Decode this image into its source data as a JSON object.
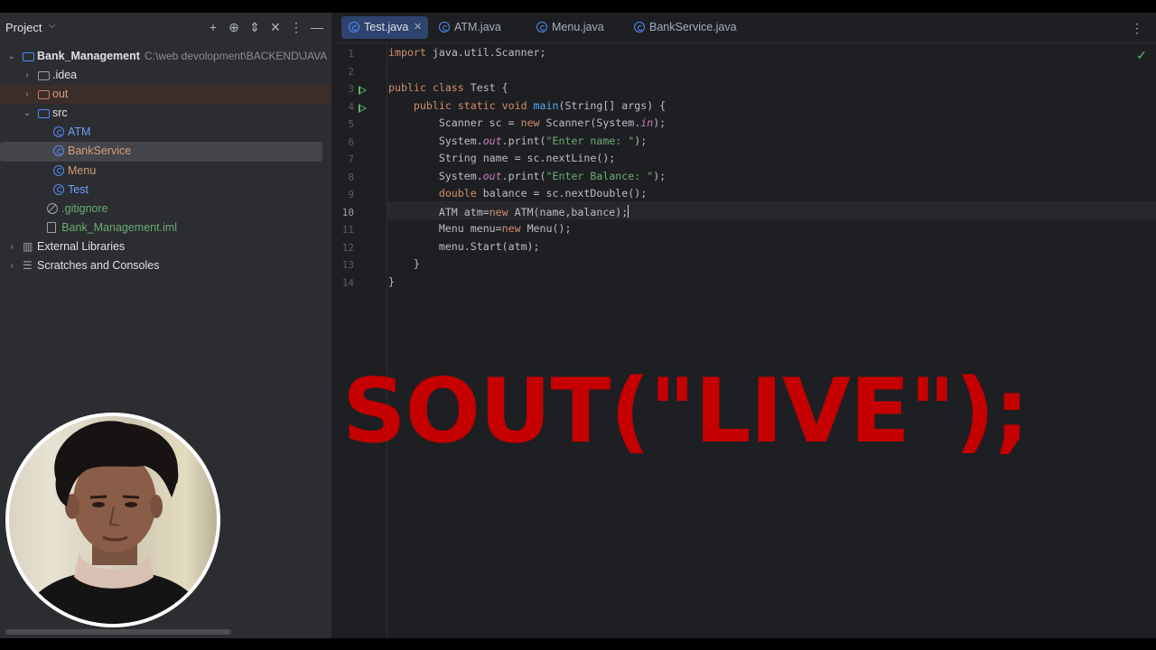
{
  "project": {
    "title": "Project",
    "tree": [
      {
        "label": "Bank_Management",
        "path": "C:\\web devolopment\\BACKEND\\JAVA",
        "icon": "module-folder-icon",
        "color": "white",
        "bold": true
      },
      {
        "label": ".idea",
        "icon": "folder-icon",
        "color": "white"
      },
      {
        "label": "out",
        "icon": "folder-icon",
        "color": "orange"
      },
      {
        "label": "src",
        "icon": "source-folder-icon",
        "color": "white"
      },
      {
        "label": "ATM",
        "icon": "java-class-icon",
        "color": "blue"
      },
      {
        "label": "BankService",
        "icon": "java-class-icon",
        "color": "orange"
      },
      {
        "label": "Menu",
        "icon": "java-class-icon",
        "color": "orange"
      },
      {
        "label": "Test",
        "icon": "java-class-icon",
        "color": "blue"
      },
      {
        "label": ".gitignore",
        "icon": "ignore-file-icon",
        "color": "green"
      },
      {
        "label": "Bank_Management.iml",
        "icon": "iml-file-icon",
        "color": "green"
      },
      {
        "label": "External Libraries",
        "icon": "library-icon",
        "color": "white"
      },
      {
        "label": "Scratches and Consoles",
        "icon": "scratches-icon",
        "color": "white"
      }
    ]
  },
  "tabs": [
    {
      "label": "Test.java",
      "active": true
    },
    {
      "label": "ATM.java",
      "active": false
    },
    {
      "label": "Menu.java",
      "active": false
    },
    {
      "label": "BankService.java",
      "active": false
    }
  ],
  "code": {
    "current_line": 10,
    "lines": [
      [
        [
          "kw",
          "import "
        ],
        [
          "",
          "java.util.Scanner;"
        ]
      ],
      [],
      [
        [
          "kw",
          "public class "
        ],
        [
          "",
          "Test {"
        ]
      ],
      [
        [
          "",
          "    "
        ],
        [
          "kw",
          "public static void "
        ],
        [
          "fn",
          "main"
        ],
        [
          "",
          "(String[] args) {"
        ]
      ],
      [
        [
          "",
          "        Scanner sc = "
        ],
        [
          "kw",
          "new "
        ],
        [
          "",
          "Scanner(System."
        ],
        [
          "it",
          "in"
        ],
        [
          "",
          ");"
        ]
      ],
      [
        [
          "",
          "        System."
        ],
        [
          "it",
          "out"
        ],
        [
          "",
          ".print("
        ],
        [
          "str",
          "\"Enter name: \""
        ],
        [
          "",
          ");"
        ]
      ],
      [
        [
          "",
          "        String name = sc.nextLine();"
        ]
      ],
      [
        [
          "",
          "        System."
        ],
        [
          "it",
          "out"
        ],
        [
          "",
          ".print("
        ],
        [
          "str",
          "\"Enter Balance: \""
        ],
        [
          "",
          ");"
        ]
      ],
      [
        [
          "",
          "        "
        ],
        [
          "kw",
          "double "
        ],
        [
          "",
          "balance = sc.nextDouble();"
        ]
      ],
      [
        [
          "",
          "        ATM atm="
        ],
        [
          "kw",
          "new "
        ],
        [
          "",
          "ATM(name,balance);"
        ]
      ],
      [
        [
          "",
          "        Menu menu="
        ],
        [
          "kw",
          "new "
        ],
        [
          "",
          "Menu();"
        ]
      ],
      [
        [
          "",
          "        menu.Start(atm);"
        ]
      ],
      [
        [
          "",
          "    }"
        ]
      ],
      [
        [
          "",
          "}"
        ]
      ]
    ]
  },
  "overlay_text": "SOUT(\"LIVE\");",
  "colors": {
    "overlay": "#c40000",
    "accent": "#548af7",
    "run": "#5fb865"
  }
}
